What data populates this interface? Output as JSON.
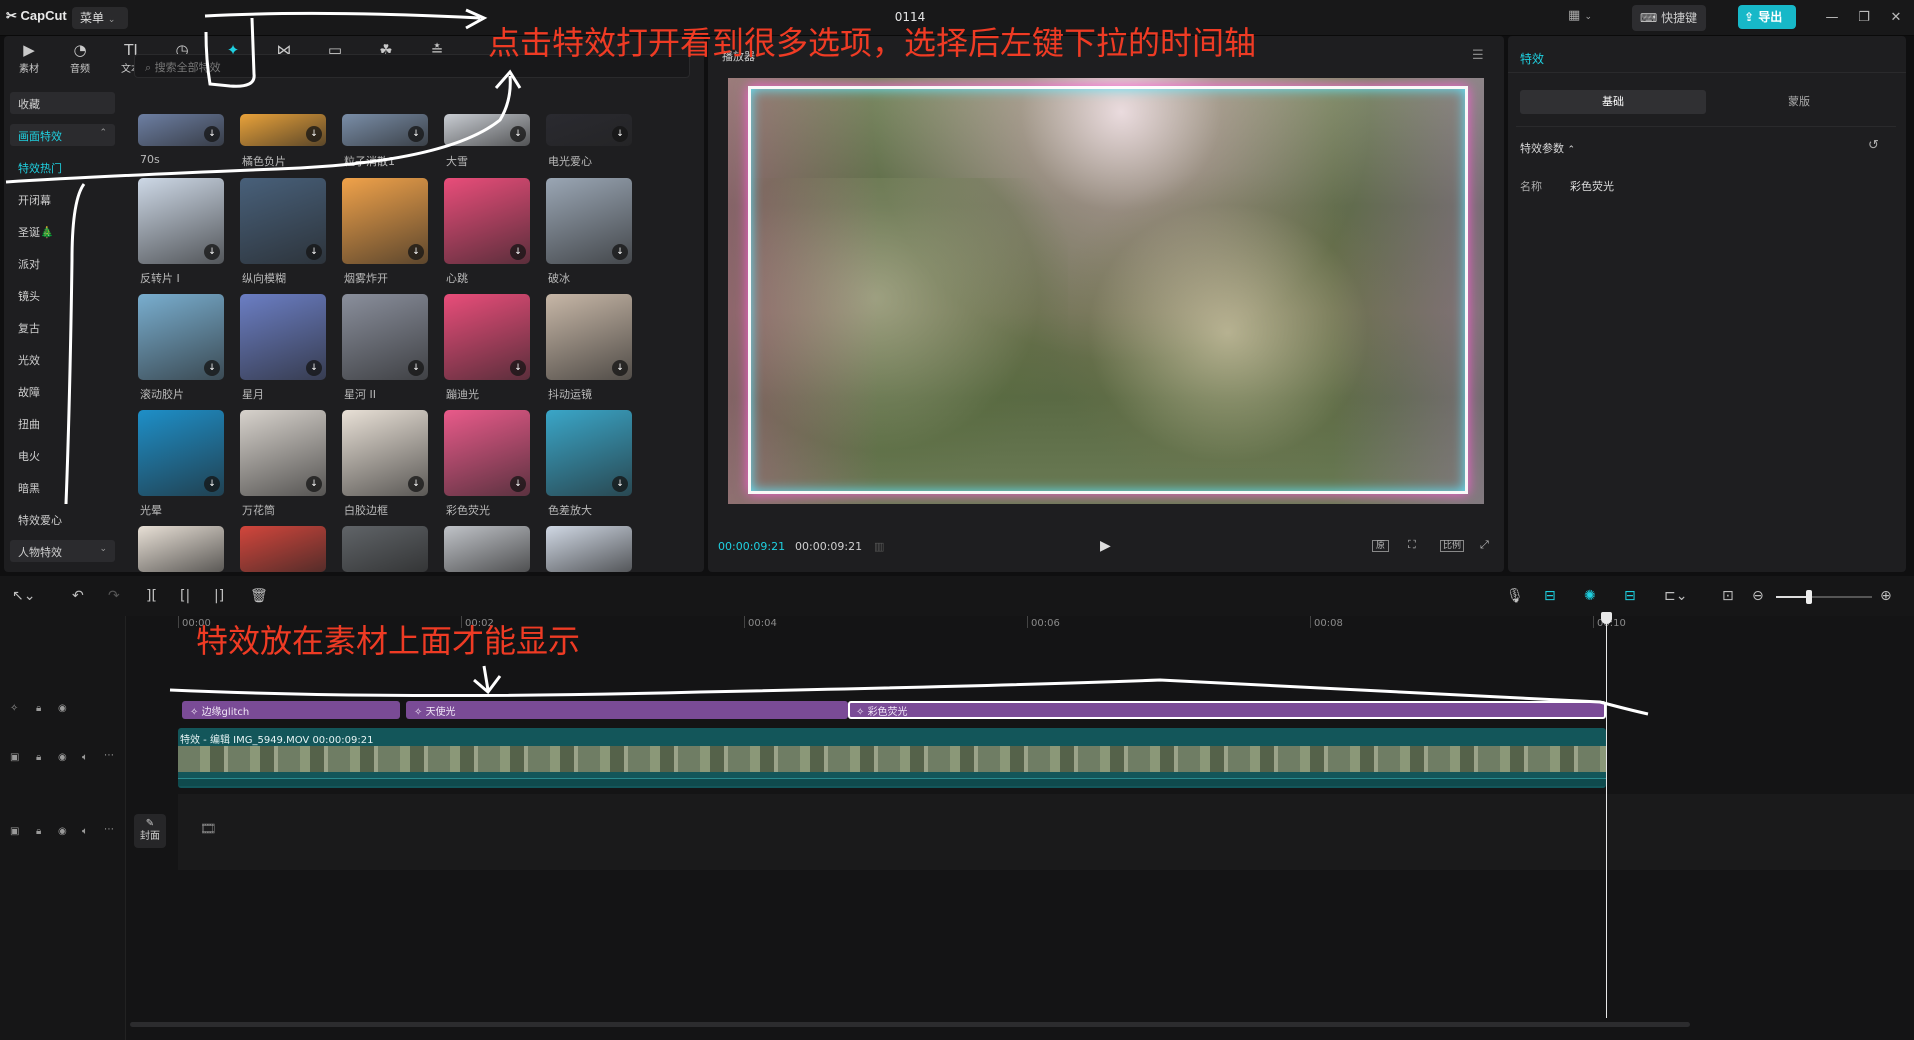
{
  "app": {
    "name": "CapCut",
    "menu_label": "菜单",
    "project_title": "0114",
    "shortcut_label": "快捷键",
    "export_label": "导出"
  },
  "toolbar": {
    "items": [
      {
        "label": "素材",
        "icon": "media-icon",
        "glyph": "▶"
      },
      {
        "label": "音频",
        "icon": "audio-icon",
        "glyph": "◔"
      },
      {
        "label": "文本",
        "icon": "text-icon",
        "glyph": "TI"
      },
      {
        "label": "贴纸",
        "icon": "sticker-icon",
        "glyph": "◷"
      },
      {
        "label": "特效",
        "icon": "effects-icon",
        "glyph": "✦",
        "active": true
      },
      {
        "label": "转场",
        "icon": "transition-icon",
        "glyph": "⋈"
      },
      {
        "label": "字幕",
        "icon": "caption-icon",
        "glyph": "▭"
      },
      {
        "label": "滤镜",
        "icon": "filter-icon",
        "glyph": "☘"
      },
      {
        "label": "调节",
        "icon": "adjust-icon",
        "glyph": "≛"
      }
    ]
  },
  "search": {
    "placeholder": "搜索全部特效"
  },
  "categories": {
    "favorites": "收藏",
    "screen_effects": "画面特效",
    "items": [
      "特效热门",
      "开闭幕",
      "圣诞🎄",
      "派对",
      "镜头",
      "复古",
      "光效",
      "故障",
      "扭曲",
      "电火",
      "暗黑",
      "特效爱心"
    ],
    "people_effects": "人物特效"
  },
  "effects": {
    "row0": [
      "70s",
      "橘色负片",
      "粒子消散1",
      "大雪",
      "电光爱心"
    ],
    "row1": [
      "反转片 I",
      "纵向模糊",
      "烟雾炸开",
      "心跳",
      "破冰"
    ],
    "row2": [
      "滚动胶片",
      "星月",
      "星河 II",
      "蹦迪光",
      "抖动运镜"
    ],
    "row3": [
      "光晕",
      "万花筒",
      "白胶边框",
      "彩色荧光",
      "色差放大"
    ]
  },
  "player": {
    "title": "播放器",
    "current_time": "00:00:09:21",
    "total_time": "00:00:09:21",
    "ctl1": "原",
    "ctl2": "比例"
  },
  "properties": {
    "title": "特效",
    "tab_basic": "基础",
    "tab_mask": "蒙版",
    "params_title": "特效参数",
    "name_label": "名称",
    "name_value": "彩色荧光"
  },
  "timeline": {
    "ticks": [
      "00:00",
      "00:02",
      "00:04",
      "00:06",
      "00:08",
      "00:10"
    ],
    "effect_clips": [
      "边缘glitch",
      "天使光",
      "彩色荧光"
    ],
    "video_clip_label": "特效 - 编辑  IMG_5949.MOV  00:00:09:21",
    "cover_label": "封面"
  },
  "annotations": {
    "top": "点击特效打开看到很多选项，选择后左键下拉的时间轴",
    "timeline": "特效放在素材上面才能显示"
  },
  "colors": {
    "accent": "#1fd0e0",
    "effect_clip": "#7a4b96",
    "video_clip": "#13565a",
    "annotation": "#ef3b24"
  }
}
